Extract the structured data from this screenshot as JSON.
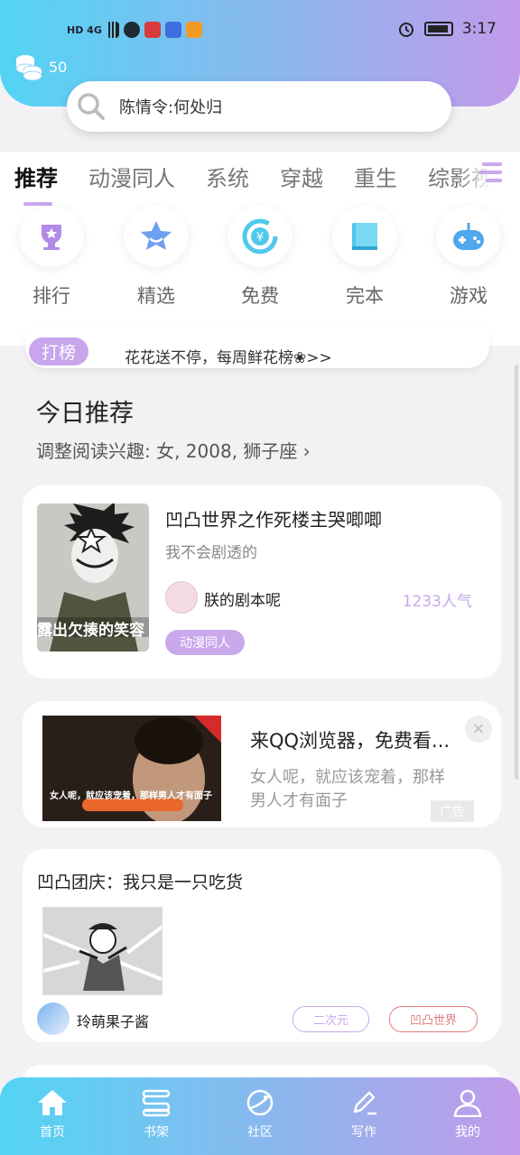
{
  "status_bar": {
    "network": "HD 4G",
    "time": "3:17"
  },
  "header": {
    "coin_count": "50",
    "search_placeholder": "陈情令:何处归"
  },
  "tabs": [
    "推荐",
    "动漫同人",
    "系统",
    "穿越",
    "重生",
    "综影视"
  ],
  "categories": [
    {
      "label": "排行",
      "icon": "trophy-icon"
    },
    {
      "label": "精选",
      "icon": "star-icon"
    },
    {
      "label": "免费",
      "icon": "yen-refresh-icon"
    },
    {
      "label": "完本",
      "icon": "book-icon"
    },
    {
      "label": "游戏",
      "icon": "gamepad-icon"
    }
  ],
  "banner": {
    "badge": "打榜",
    "text": "花花送不停，每周鲜花榜❀>>"
  },
  "today": {
    "title": "今日推荐",
    "subtitle": "调整阅读兴趣: 女, 2008, 狮子座 ›"
  },
  "book": {
    "title": "凹凸世界之作死楼主哭唧唧",
    "intro": "我不会剧透的",
    "author": "朕的剧本呢",
    "popularity": "1233人气",
    "tag": "动漫同人",
    "cover_caption": "露出欠揍的笑容"
  },
  "ad": {
    "title": "来QQ浏览器，免费看...",
    "description": "女人呢，就应该宠着，那样男人才有面子",
    "image_caption": "女人呢，就应该宠着，那样男人才有面子",
    "label": "广告",
    "close": "×"
  },
  "post": {
    "title": "凹凸团庆：我只是一只吃货",
    "author": "玲萌果子酱",
    "tags": [
      "二次元",
      "凹凸世界"
    ]
  },
  "bottom_nav": [
    {
      "label": "首页",
      "icon": "home-icon"
    },
    {
      "label": "书架",
      "icon": "bookshelf-icon"
    },
    {
      "label": "社区",
      "icon": "planet-icon"
    },
    {
      "label": "写作",
      "icon": "pen-icon"
    },
    {
      "label": "我的",
      "icon": "user-icon"
    }
  ],
  "colors": {
    "accent": "#c9a8ec",
    "header_start": "#52d4f3",
    "header_end": "#c19bea",
    "tag_red": "#e07b7b"
  }
}
